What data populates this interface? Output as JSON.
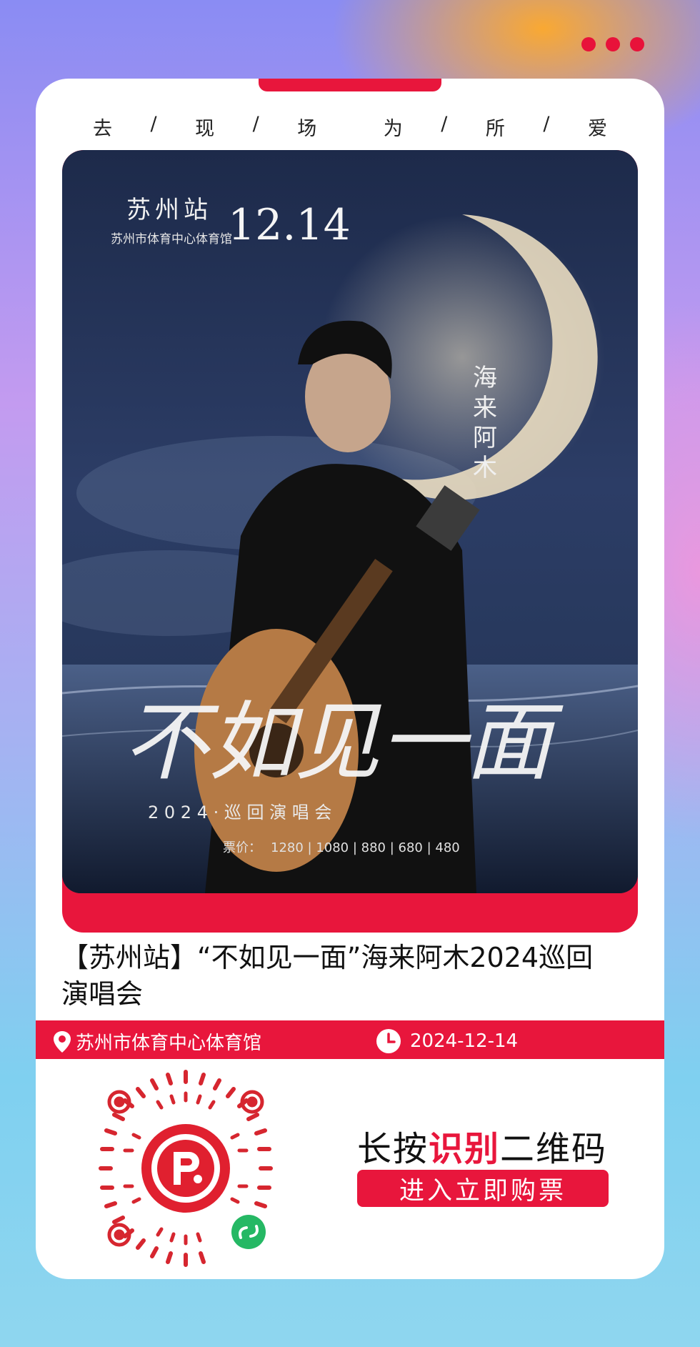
{
  "menu_icon": "more-dots-icon",
  "slogan": [
    "去",
    "/",
    "现",
    "/",
    "场",
    "为",
    "/",
    "所",
    "/",
    "爱"
  ],
  "poster": {
    "station": "苏州站",
    "venue": "苏州市体育中心体育馆",
    "date": "12.14",
    "artist": [
      "海",
      "来",
      "阿",
      "木"
    ],
    "headline": "不如见一面",
    "tour": "2 0 2 4 · 巡 回 演 唱 会",
    "prices_label": "票价：",
    "prices": "1280 | 1080 | 880 | 680 | 480"
  },
  "event": {
    "title": "【苏州站】“不如见一面”海来阿木2024巡回演唱会",
    "location": "苏州市体育中心体育馆",
    "date": "2024-12-14"
  },
  "cta": {
    "text_before": "长按",
    "text_highlight": "识别",
    "text_after": "二维码",
    "button": "进入立即购票"
  },
  "colors": {
    "accent": "#e8163c"
  }
}
